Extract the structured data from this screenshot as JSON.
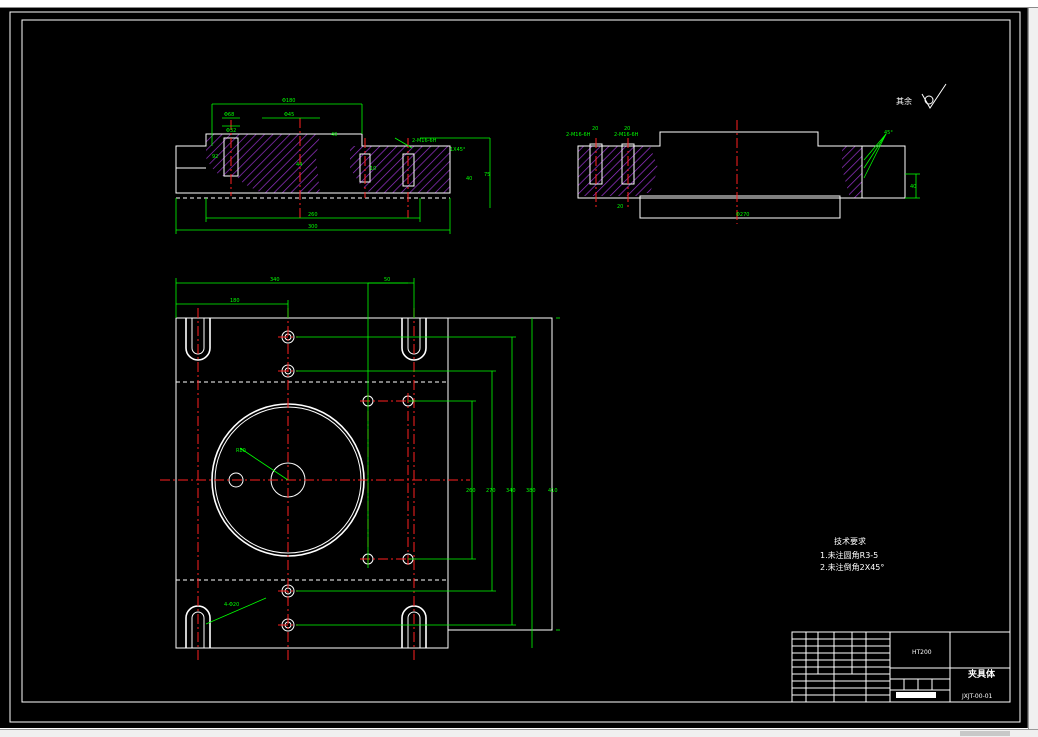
{
  "tech_requirements": {
    "title": "技术要求",
    "item1": "1.未注圆角R3-5",
    "item2": "2.未注倒角2X45°"
  },
  "roughness_note": "其余",
  "title_block": {
    "material": "HT200",
    "part_name": "夹具体",
    "drawing_no": "JXJT-00-01"
  },
  "section_view": {
    "dims": {
      "top_width": "Φ180",
      "d1": "Φ68",
      "d2": "Φ32",
      "d3": "Φ45",
      "pcd_left": "92",
      "hole_h": "44",
      "right_h": "40",
      "height_total": "75",
      "chamfer1": "1X45°",
      "thread": "2-M16-6H",
      "bottom_inner": "260",
      "bottom_total": "300",
      "mid": "40",
      "small": "10"
    }
  },
  "side_view": {
    "dims": {
      "thread_left": "2-M16-6H",
      "thread_right": "2-M16-6H",
      "small1": "20",
      "small2": "20",
      "angle": "45°",
      "height": "40",
      "bottom": "Φ270",
      "foot": "20"
    }
  },
  "plan_view": {
    "dims": {
      "width_total": "340",
      "width_half": "180",
      "offset": "50",
      "radius": "R80",
      "hole_note": "4-Φ20",
      "v1": "260",
      "v2": "270",
      "v3": "340",
      "v4": "380",
      "v5": "410"
    }
  },
  "colors": {
    "background": "#000000",
    "outline": "#ffffff",
    "centerline": "#ff2020",
    "dimension": "#00ff00",
    "hatch": "#9933cc"
  }
}
